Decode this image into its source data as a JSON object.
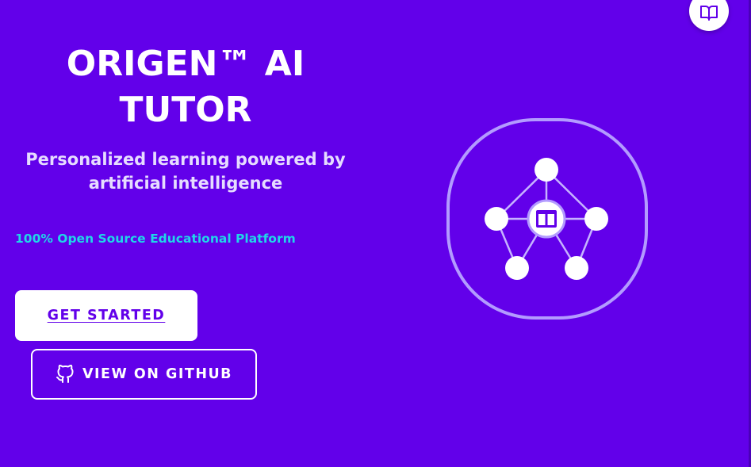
{
  "hero": {
    "title_line1": "ORIGEN™ AI",
    "title_line2": "TUTOR",
    "subtitle_line1": "Personalized learning powered by",
    "subtitle_line2": "artificial intelligence",
    "tagline": "100% Open Source Educational Platform"
  },
  "actions": {
    "get_started_label": "GET STARTED",
    "github_label": "VIEW ON GITHUB"
  },
  "icons": {
    "fab": "book-open-icon",
    "github": "github-icon",
    "illustration": "network-graph-icon",
    "center_node": "book-icon"
  },
  "colors": {
    "background": "#6200ea",
    "title": "#ffffff",
    "subtitle": "#e6dcff",
    "tagline": "#1fd6e8",
    "primary_button_bg": "#ffffff",
    "primary_button_text": "#6200ea"
  }
}
